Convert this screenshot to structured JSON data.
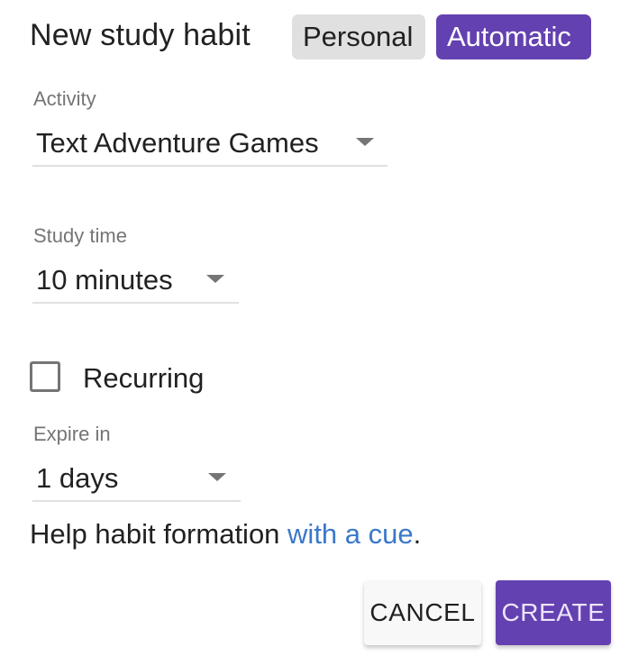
{
  "header": {
    "title": "New study habit",
    "modes": [
      {
        "label": "Personal",
        "selected": false
      },
      {
        "label": "Automatic",
        "selected": true
      }
    ]
  },
  "form": {
    "activity": {
      "label": "Activity",
      "value": "Text Adventure Games"
    },
    "study_time": {
      "label": "Study time",
      "value": "10 minutes"
    },
    "recurring": {
      "label": "Recurring",
      "checked": false
    },
    "expire_in": {
      "label": "Expire in",
      "value": "1 days"
    }
  },
  "help": {
    "text": "Help habit formation ",
    "link": "with a cue",
    "suffix": "."
  },
  "actions": {
    "cancel_label": "CANCEL",
    "create_label": "CREATE"
  },
  "colors": {
    "accent": "#6441b0",
    "link": "#3a78c9",
    "chip_inactive": "#e0e0e0"
  }
}
